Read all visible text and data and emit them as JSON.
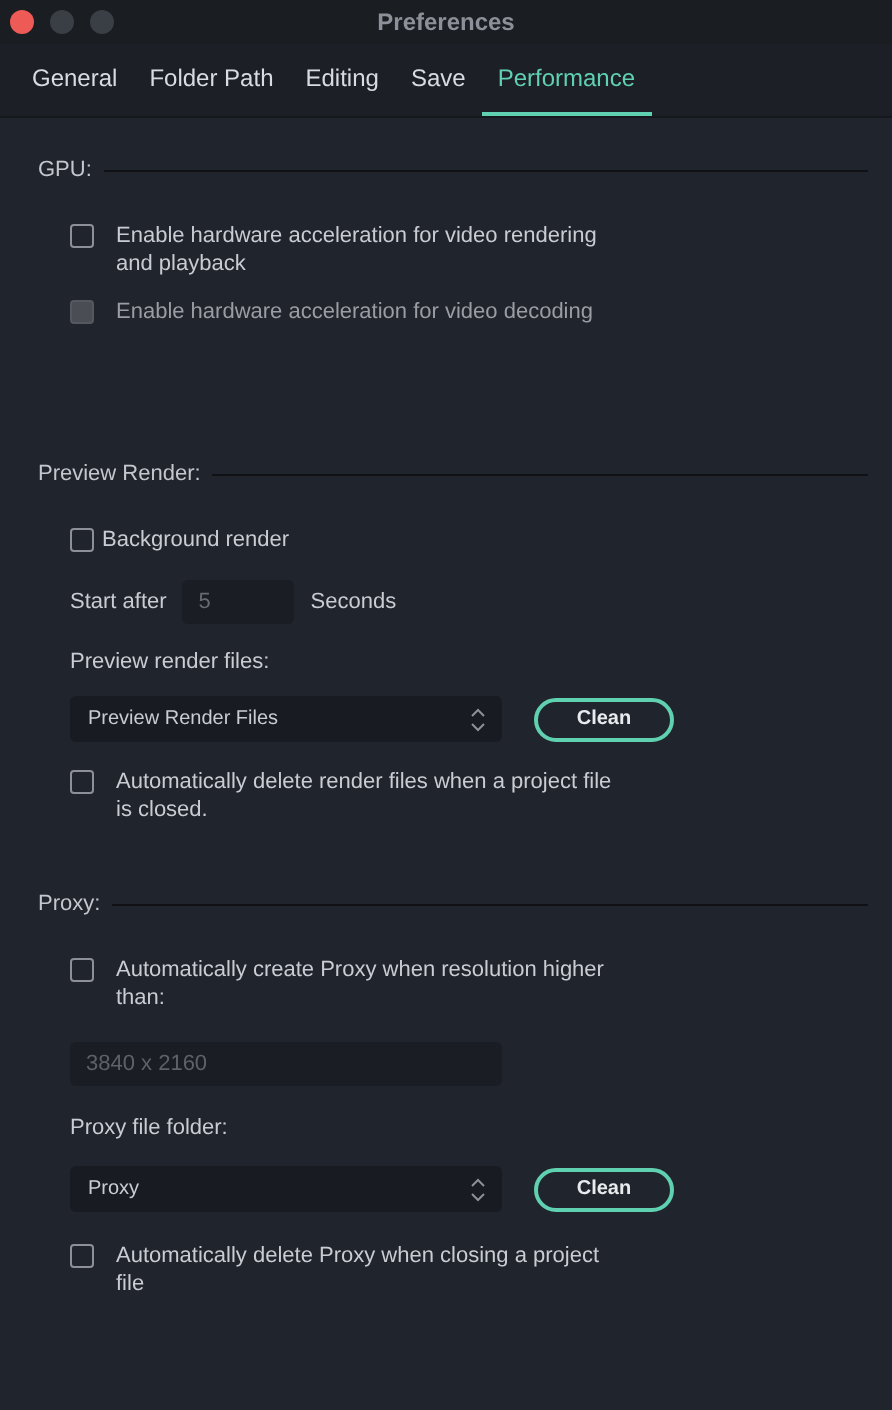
{
  "window": {
    "title": "Preferences"
  },
  "tabs": [
    {
      "label": "General",
      "selected": false
    },
    {
      "label": "Folder Path",
      "selected": false
    },
    {
      "label": "Editing",
      "selected": false
    },
    {
      "label": "Save",
      "selected": false
    },
    {
      "label": "Performance",
      "selected": true
    }
  ],
  "sections": [
    {
      "title": "GPU:",
      "items": [
        {
          "kind": "checkbox",
          "label": "Enable hardware acceleration for video rendering and playback",
          "checked": false,
          "disabled": false
        },
        {
          "kind": "checkbox",
          "label": "Enable hardware acceleration for video decoding",
          "checked": false,
          "disabled": true
        }
      ]
    },
    {
      "title": "Preview Render:",
      "items": [
        {
          "kind": "checkbox",
          "label": "Background render",
          "checked": false,
          "disabled": false,
          "compact": true
        },
        {
          "kind": "number",
          "label": "Start after",
          "placeholder": "5",
          "unit": "Seconds"
        },
        {
          "kind": "label",
          "label": "Preview render files:"
        },
        {
          "kind": "select",
          "value": "Preview Render Files",
          "button": "Clean"
        },
        {
          "kind": "checkbox",
          "label": "Automatically delete render files when a project file is closed.",
          "checked": false,
          "disabled": false
        }
      ]
    },
    {
      "title": "Proxy:",
      "items": [
        {
          "kind": "checkbox",
          "label": "Automatically create Proxy when resolution higher than:",
          "checked": false,
          "disabled": false
        },
        {
          "kind": "text",
          "placeholder": "3840 x 2160"
        },
        {
          "kind": "label",
          "label": "Proxy file folder:"
        },
        {
          "kind": "select",
          "value": "Proxy",
          "button": "Clean"
        },
        {
          "kind": "checkbox",
          "label": "Automatically delete Proxy when closing a project file",
          "checked": false,
          "disabled": false
        }
      ]
    }
  ]
}
